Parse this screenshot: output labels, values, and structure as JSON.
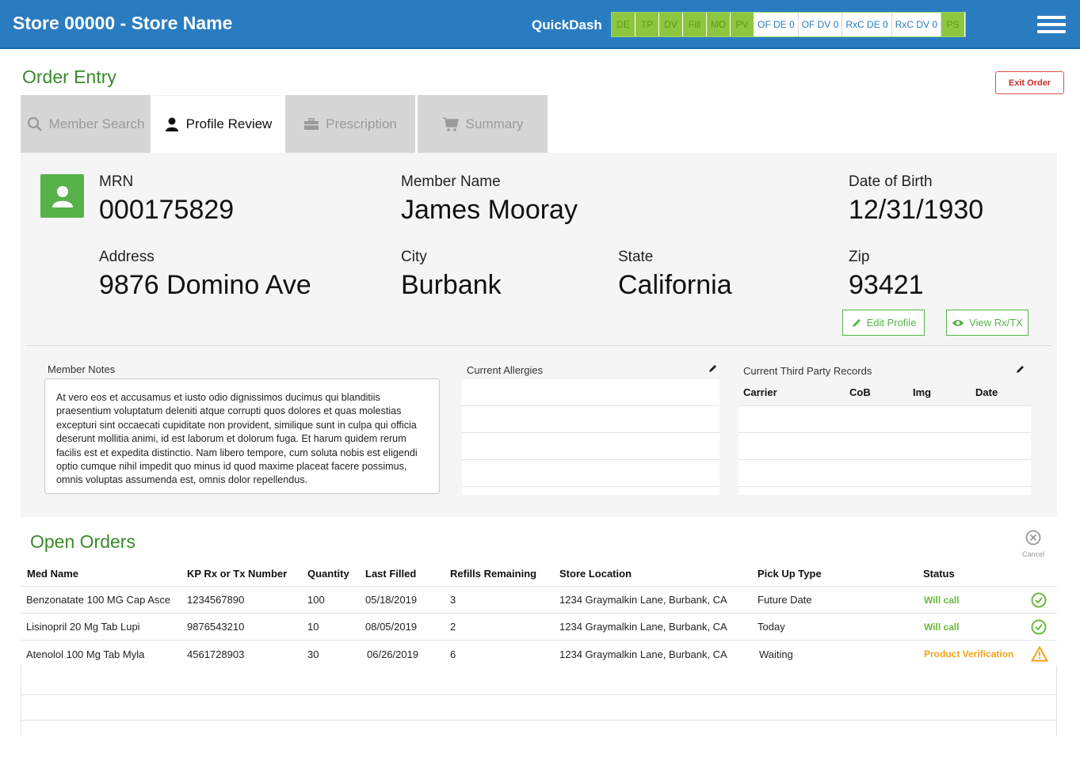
{
  "header": {
    "store_title": "Store 00000 - Store Name",
    "quickdash_label": "QuickDash",
    "quickdash_green": [
      "DE",
      "TP",
      "DV",
      "Fill",
      "MO",
      "PV"
    ],
    "quickdash_white": [
      "OF DE 0",
      "OF DV 0",
      "RxC DE 0",
      "RxC DV 0"
    ],
    "quickdash_end": "PS"
  },
  "page": {
    "title": "Order Entry",
    "exit_label": "Exit Order"
  },
  "tabs": [
    {
      "label": "Member Search",
      "icon": "search-icon"
    },
    {
      "label": "Profile Review",
      "icon": "user-icon"
    },
    {
      "label": "Prescription",
      "icon": "briefcase-icon"
    },
    {
      "label": "Summary",
      "icon": "cart-icon"
    }
  ],
  "profile": {
    "mrn_label": "MRN",
    "mrn": "000175829",
    "name_label": "Member Name",
    "name": "James Mooray",
    "dob_label": "Date of Birth",
    "dob": "12/31/1930",
    "address_label": "Address",
    "address": "9876 Domino Ave",
    "city_label": "City",
    "city": "Burbank",
    "state_label": "State",
    "state": "California",
    "zip_label": "Zip",
    "zip": "93421",
    "edit_label": "Edit Profile",
    "view_label": "View Rx/TX"
  },
  "notes": {
    "label": "Member Notes",
    "text": "At vero eos et accusamus et iusto odio dignissimos ducimus qui blanditiis praesentium voluptatum deleniti atque corrupti quos dolores et quas molestias excepturi sint occaecati cupiditate non provident, similique sunt in culpa qui officia deserunt mollitia animi, id est laborum et dolorum fuga. Et harum quidem rerum facilis est et expedita distinctio. Nam libero tempore, cum soluta nobis est eligendi optio cumque nihil impedit quo minus id quod maxime placeat facere possimus, omnis voluptas assumenda est, omnis dolor repellendus."
  },
  "allergies": {
    "label": "Current Allergies"
  },
  "third_party": {
    "label": "Current Third Party Records",
    "columns": [
      "Carrier",
      "CoB",
      "Img",
      "Date"
    ]
  },
  "orders": {
    "title": "Open Orders",
    "cancel_label": "Cancel",
    "columns": [
      "Med Name",
      "KP Rx or Tx Number",
      "Quantity",
      "Last Filled",
      "Refills Remaining",
      "Store Location",
      "Pick Up Type",
      "Status"
    ],
    "rows": [
      {
        "med": "Benzonatate 100 MG Cap Asce",
        "rx": "1234567890",
        "qty": "100",
        "last": "05/18/2019",
        "refills": "3",
        "loc": "1234 Graymalkin Lane, Burbank, CA",
        "pickup": "Future Date",
        "status": "Will call",
        "status_icon": "check-circle-icon"
      },
      {
        "med": "Lisinopril 20 Mg Tab Lupi",
        "rx": "9876543210",
        "qty": "10",
        "last": "08/05/2019",
        "refills": "2",
        "loc": "1234 Graymalkin Lane, Burbank, CA",
        "pickup": "Today",
        "status": "Will call",
        "status_icon": "check-circle-icon"
      },
      {
        "med": "Atenolol 100 Mg Tab Myla",
        "rx": "4561728903",
        "qty": "30",
        "last": "06/26/2019",
        "refills": "6",
        "loc": "1234 Graymalkin Lane, Burbank, CA",
        "pickup": "Waiting",
        "status": "Product Verification",
        "status_icon": "warning-icon"
      }
    ]
  },
  "colors": {
    "header_blue": "#2a7cc1",
    "brand_green": "#3a8a2a",
    "accent_green": "#57b24a",
    "warning_orange": "#f2a31b",
    "danger_red": "#d9534f"
  }
}
